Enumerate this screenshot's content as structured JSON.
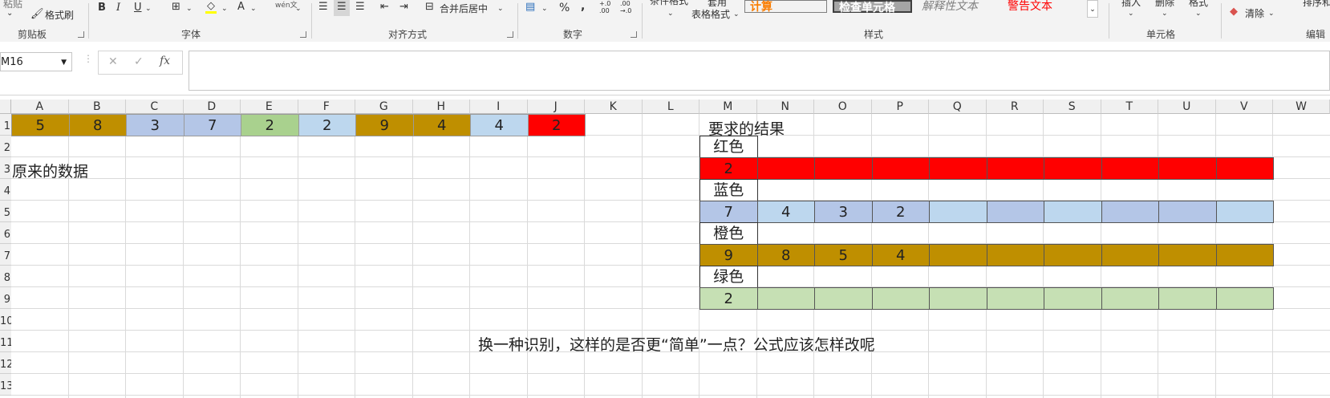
{
  "ribbon": {
    "clipboard": {
      "paste": "粘贴",
      "format_painter": "格式刷",
      "label": "剪贴板"
    },
    "font": {
      "bold": "B",
      "italic": "I",
      "underline": "U",
      "font_color": "A",
      "phonetic": "wén文",
      "label": "字体"
    },
    "alignment": {
      "merge_center": "合并后居中",
      "label": "对齐方式"
    },
    "number": {
      "percent": "%",
      "comma": ",",
      "inc_decimal": "+.0 .00",
      "dec_decimal": ".00 →.0",
      "label": "数字"
    },
    "styles": {
      "cond_format": "条件格式",
      "table_format_top": "套用",
      "table_format": "表格格式",
      "calc": "计算",
      "check_cell": "检查单元格",
      "explanatory": "解释性文本",
      "warning": "警告文本",
      "label": "样式"
    },
    "cells": {
      "insert": "插入",
      "delete": "删除",
      "format": "格式",
      "label": "单元格"
    },
    "editing": {
      "clear": "清除",
      "sort": "排序和",
      "label": "编辑"
    }
  },
  "formula_bar": {
    "name_box": "M16",
    "cancel": "✕",
    "enter": "✓",
    "fx": "fx",
    "formula": ""
  },
  "columns": [
    "A",
    "B",
    "C",
    "D",
    "E",
    "F",
    "G",
    "H",
    "I",
    "J",
    "K",
    "L",
    "M",
    "N",
    "O",
    "P",
    "Q",
    "R",
    "S",
    "T",
    "U",
    "V",
    "W"
  ],
  "rows": [
    "1",
    "2",
    "3",
    "4",
    "5",
    "6",
    "7",
    "8",
    "9",
    "10",
    "11",
    "12",
    "13"
  ],
  "colors": {
    "orange": "#bf8f00",
    "blue": "#b4c6e7",
    "lightblue": "#bdd7ee",
    "green": "#a9d18e",
    "lightgreen": "#c6e0b4",
    "red": "#ff0000"
  },
  "source_row": [
    {
      "col": "A",
      "value": "5",
      "color": "orange"
    },
    {
      "col": "B",
      "value": "8",
      "color": "orange"
    },
    {
      "col": "C",
      "value": "3",
      "color": "blue"
    },
    {
      "col": "D",
      "value": "7",
      "color": "blue"
    },
    {
      "col": "E",
      "value": "2",
      "color": "green"
    },
    {
      "col": "F",
      "value": "2",
      "color": "lightblue"
    },
    {
      "col": "G",
      "value": "9",
      "color": "orange"
    },
    {
      "col": "H",
      "value": "4",
      "color": "orange"
    },
    {
      "col": "I",
      "value": "4",
      "color": "lightblue"
    },
    {
      "col": "J",
      "value": "2",
      "color": "red"
    }
  ],
  "labels": {
    "original": "原来的数据",
    "result_title": "要求的结果",
    "red": "红色",
    "blue": "蓝色",
    "orange": "橙色",
    "green": "绿色",
    "question": "换一种识别，这样的是否更“简单”一点？公式应该怎样改呢"
  },
  "result_rows": {
    "red": {
      "color": "red",
      "values": [
        "2",
        "",
        "",
        "",
        "",
        "",
        "",
        "",
        "",
        ""
      ],
      "fills": [
        "red",
        "red",
        "red",
        "red",
        "red",
        "red",
        "red",
        "red",
        "red",
        "red"
      ]
    },
    "blue": {
      "values": [
        "7",
        "4",
        "3",
        "2",
        "",
        "",
        "",
        "",
        "",
        ""
      ],
      "fills": [
        "blue",
        "lightblue",
        "blue",
        "blue",
        "lightblue",
        "blue",
        "lightblue",
        "blue",
        "blue",
        "lightblue"
      ]
    },
    "orange": {
      "values": [
        "9",
        "8",
        "5",
        "4",
        "",
        "",
        "",
        "",
        "",
        ""
      ],
      "fills": [
        "orange",
        "orange",
        "orange",
        "orange",
        "orange",
        "orange",
        "orange",
        "orange",
        "orange",
        "orange"
      ]
    },
    "green": {
      "values": [
        "2",
        "",
        "",
        "",
        "",
        "",
        "",
        "",
        "",
        ""
      ],
      "fills": [
        "lightgreen",
        "lightgreen",
        "lightgreen",
        "lightgreen",
        "lightgreen",
        "lightgreen",
        "lightgreen",
        "lightgreen",
        "lightgreen",
        "lightgreen"
      ]
    }
  }
}
